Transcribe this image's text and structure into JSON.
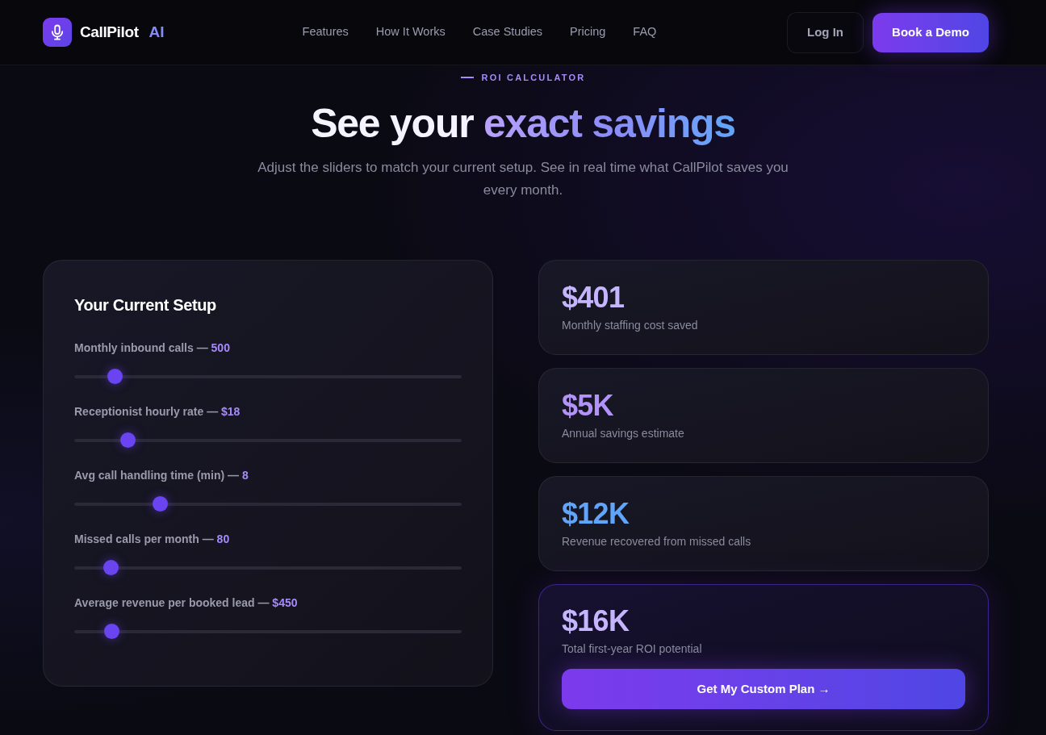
{
  "nav": {
    "brand": {
      "name": "CallPilot",
      "suffix": "AI"
    },
    "links": [
      {
        "label": "Features"
      },
      {
        "label": "How It Works"
      },
      {
        "label": "Case Studies"
      },
      {
        "label": "Pricing"
      },
      {
        "label": "FAQ"
      }
    ],
    "buttons": [
      {
        "label": "Log In",
        "kind": "secondary"
      },
      {
        "label": "Book a Demo",
        "kind": "primary"
      }
    ]
  },
  "hero": {
    "eyebrow": "ROI CALCULATOR",
    "title": "See your",
    "title_highlight": "exact savings",
    "subtitle": "Adjust the sliders to match your current setup. See in real time what CallPilot saves you every month."
  },
  "setup_panel": {
    "title": "Your Current Setup",
    "sliders": [
      {
        "label": "Monthly inbound calls —",
        "value": "500",
        "level": 0.088
      },
      {
        "label": "Receptionist hourly rate —",
        "value": "$18",
        "level": 0.123
      },
      {
        "label": "Avg call handling time (min) —",
        "value": "8",
        "level": 0.211
      },
      {
        "label": "Missed calls per month —",
        "value": "80",
        "level": 0.079
      },
      {
        "label": "Average revenue per booked lead —",
        "value": "$450",
        "level": 0.081
      }
    ]
  },
  "results": [
    {
      "kind": "stat",
      "value": "$401",
      "label": "Monthly staffing cost saved",
      "color": "#c4b5fd"
    },
    {
      "kind": "stat",
      "value": "$5K",
      "label": "Annual savings estimate",
      "color": "#b392fa"
    },
    {
      "kind": "stat",
      "value": "$12K",
      "label": "Revenue recovered from missed calls",
      "color": "#60a5fa"
    },
    {
      "kind": "total",
      "value": "$16K",
      "label": "Total first-year ROI potential",
      "color": "#c4b5fd",
      "button": "Get My Custom Plan →"
    }
  ]
}
